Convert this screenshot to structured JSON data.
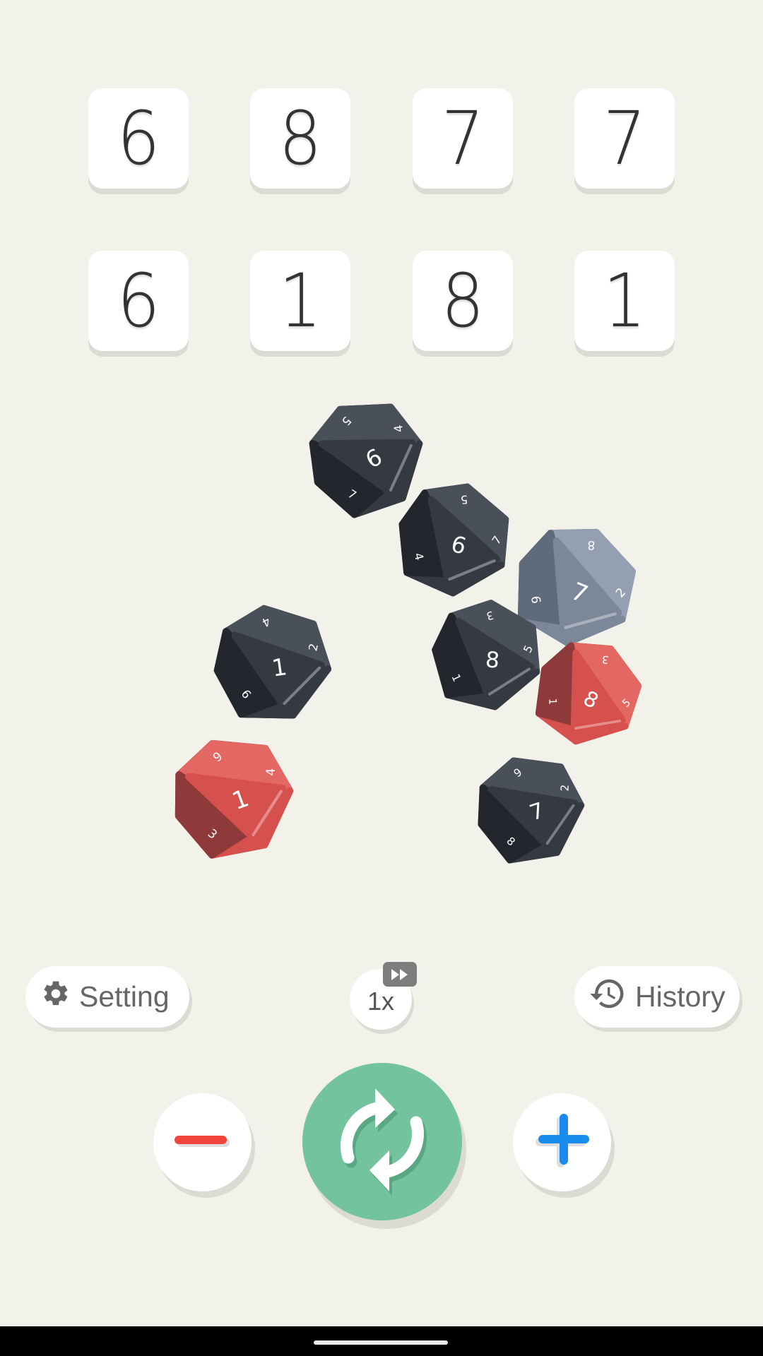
{
  "results": {
    "row1": [
      "6",
      "8",
      "7",
      "7"
    ],
    "row2": [
      "6",
      "1",
      "8",
      "1"
    ]
  },
  "dice": [
    {
      "face": "6",
      "color": "dark",
      "side_labels": [
        "5",
        "4",
        "7"
      ]
    },
    {
      "face": "6",
      "color": "dark",
      "side_labels": [
        "5",
        "7",
        "4"
      ]
    },
    {
      "face": "7",
      "color": "grey",
      "side_labels": [
        "8",
        "2",
        "6"
      ]
    },
    {
      "face": "1",
      "color": "dark",
      "side_labels": [
        "4",
        "2",
        "6"
      ]
    },
    {
      "face": "8",
      "color": "dark",
      "side_labels": [
        "3",
        "5",
        "1"
      ]
    },
    {
      "face": "8",
      "color": "red",
      "side_labels": [
        "3",
        "5",
        "1"
      ]
    },
    {
      "face": "1",
      "color": "red",
      "side_labels": [
        "6",
        "4",
        "3"
      ]
    },
    {
      "face": "7",
      "color": "dark",
      "side_labels": [
        "6",
        "2",
        "8"
      ]
    }
  ],
  "colors": {
    "background": "#f3f2ea",
    "dark_die": "#353a42",
    "grey_die": "#7c889a",
    "red_die": "#d6514d",
    "roll_button": "#72c39e",
    "minus": "#f0443a",
    "plus": "#1a8cf0"
  },
  "toolbar": {
    "setting_label": "Setting",
    "setting_icon": "gear-icon",
    "speed_label": "1x",
    "speed_icon": "fast-forward-icon",
    "history_label": "History",
    "history_icon": "history-icon"
  },
  "controls": {
    "remove_icon": "minus-icon",
    "roll_icon": "refresh-icon",
    "add_icon": "plus-icon"
  }
}
